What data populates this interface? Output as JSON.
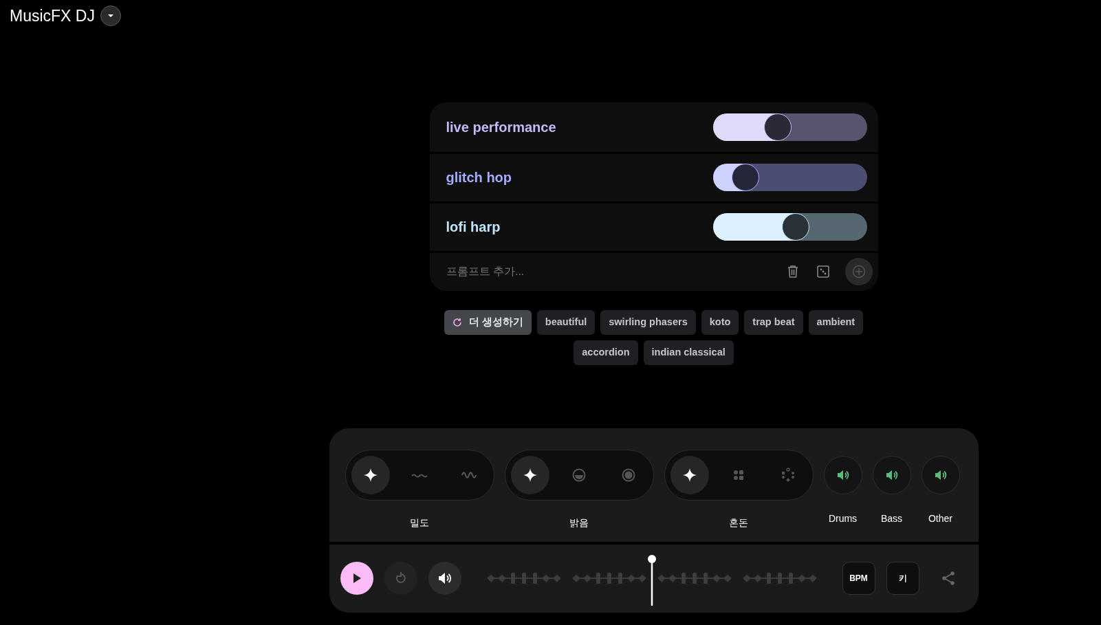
{
  "app": {
    "title": "MusicFX DJ"
  },
  "prompts": [
    {
      "text": "live performance",
      "level": 0.42,
      "color": "#c5b9f5"
    },
    {
      "text": "glitch hop",
      "level": 0.21,
      "color": "#a6adff"
    },
    {
      "text": "lofi harp",
      "level": 0.54,
      "color": "#bfe4fb"
    }
  ],
  "prompt_input": {
    "placeholder": "프롬프트 추가..."
  },
  "suggestions": [
    {
      "kind": "action",
      "label": "더 생성하기"
    },
    {
      "kind": "chip",
      "label": "beautiful"
    },
    {
      "kind": "chip",
      "label": "swirling phasers"
    },
    {
      "kind": "chip",
      "label": "koto"
    },
    {
      "kind": "chip",
      "label": "trap beat"
    },
    {
      "kind": "chip",
      "label": "ambient"
    },
    {
      "kind": "chip",
      "label": "accordion"
    },
    {
      "kind": "chip",
      "label": "indian classical"
    }
  ],
  "controls": {
    "groups": [
      {
        "label": "밀도",
        "options": [
          {
            "kind": "auto",
            "selected": true
          },
          {
            "kind": "wave-low",
            "selected": false
          },
          {
            "kind": "wave-high",
            "selected": false
          }
        ]
      },
      {
        "label": "밝음",
        "options": [
          {
            "kind": "auto",
            "selected": true
          },
          {
            "kind": "half-circle",
            "selected": false
          },
          {
            "kind": "ring-dot",
            "selected": false
          }
        ]
      },
      {
        "label": "혼돈",
        "options": [
          {
            "kind": "auto",
            "selected": true
          },
          {
            "kind": "dots-grid",
            "selected": false
          },
          {
            "kind": "dots-scatter",
            "selected": false
          }
        ]
      }
    ],
    "stems": [
      {
        "label": "Drums",
        "on": true
      },
      {
        "label": "Bass",
        "on": true
      },
      {
        "label": "Other",
        "on": true
      }
    ]
  },
  "transport": {
    "playing": false,
    "playhead": {
      "level": 0.5
    },
    "buttons": [
      "BPM",
      "키"
    ]
  }
}
